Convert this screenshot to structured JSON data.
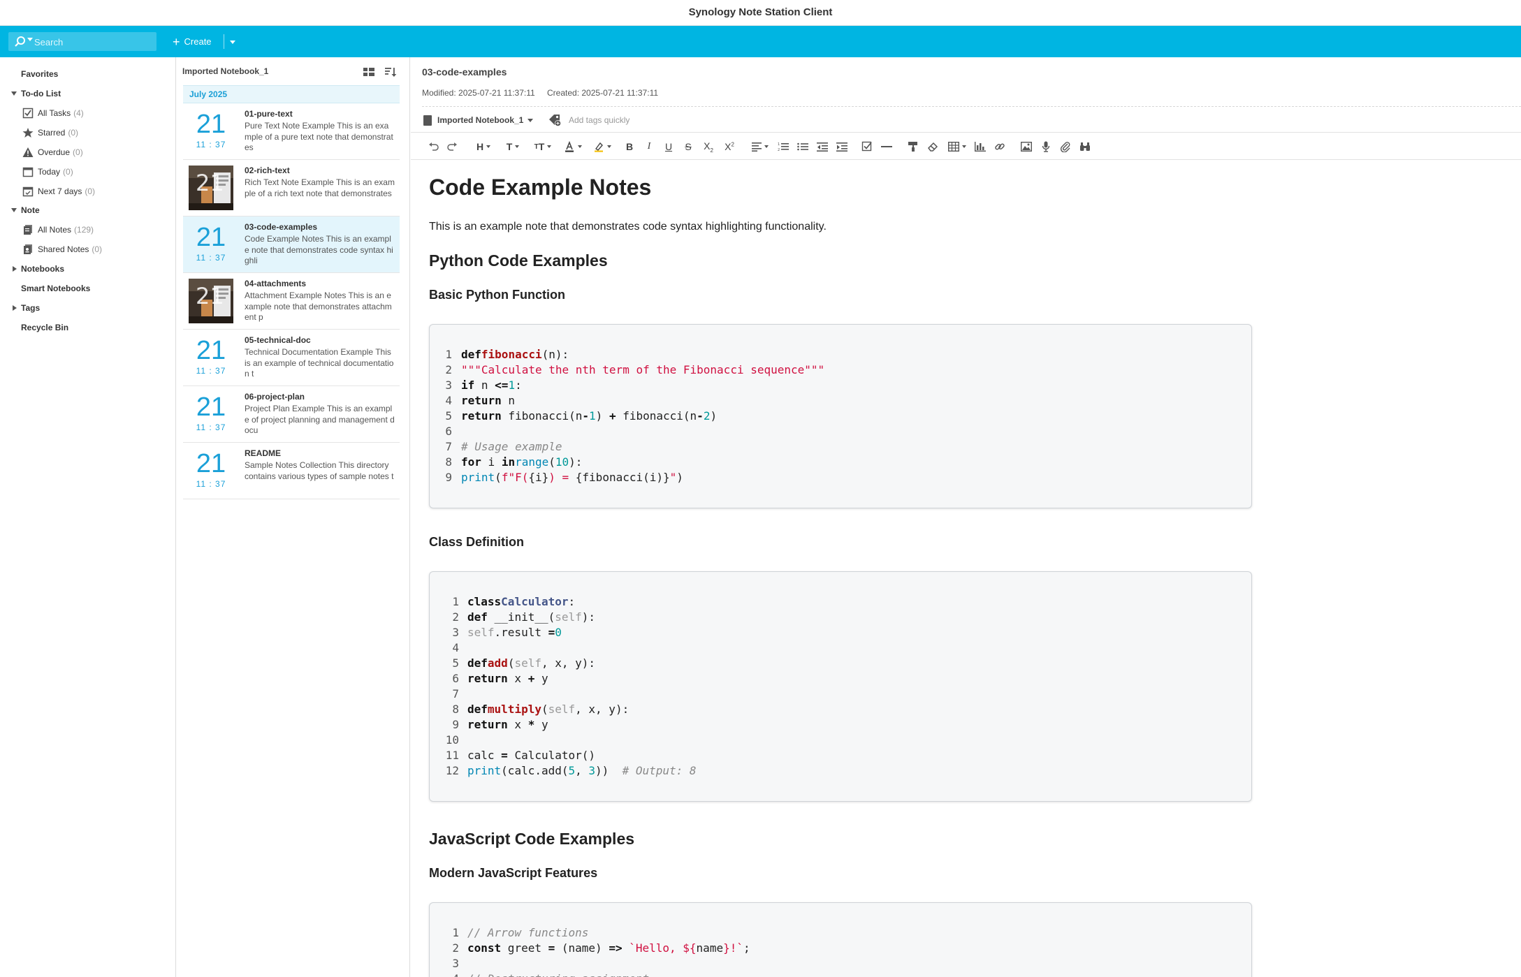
{
  "window": {
    "title": "Synology Note Station Client"
  },
  "topbar": {
    "search_placeholder": "Search",
    "create_label": "Create"
  },
  "sidebar": {
    "favorites": "Favorites",
    "todo": "To-do List",
    "todo_items": [
      {
        "label": "All Tasks",
        "count": "(4)"
      },
      {
        "label": "Starred",
        "count": "(0)"
      },
      {
        "label": "Overdue",
        "count": "(0)"
      },
      {
        "label": "Today",
        "count": "(0)"
      },
      {
        "label": "Next 7 days",
        "count": "(0)"
      }
    ],
    "note": "Note",
    "note_items": [
      {
        "label": "All Notes",
        "count": "(129)"
      },
      {
        "label": "Shared Notes",
        "count": "(0)"
      }
    ],
    "notebooks": "Notebooks",
    "smart_notebooks": "Smart Notebooks",
    "tags": "Tags",
    "recycle_bin": "Recycle Bin"
  },
  "notelist": {
    "notebook": "Imported Notebook_1",
    "month": "July 2025",
    "notes": [
      {
        "day": "21",
        "time": "11 : 37",
        "title": "01-pure-text",
        "summary": "Pure Text Note Example This is an example of a pure text note that demonstrates",
        "thumb": false
      },
      {
        "day": "21",
        "time": "11 : 37",
        "title": "02-rich-text",
        "summary": "Rich Text Note Example This is an example of a rich text note that demonstrates",
        "thumb": true
      },
      {
        "day": "21",
        "time": "11 : 37",
        "title": "03-code-examples",
        "summary": "Code Example Notes This is an example note that demonstrates code syntax highli",
        "thumb": false,
        "selected": true
      },
      {
        "day": "21",
        "time": "11 : 37",
        "title": "04-attachments",
        "summary": "Attachment Example Notes This is an example note that demonstrates attachment p",
        "thumb": true
      },
      {
        "day": "21",
        "time": "11 : 37",
        "title": "05-technical-doc",
        "summary": "Technical Documentation Example This is an example of technical documentation t",
        "thumb": false
      },
      {
        "day": "21",
        "time": "11 : 37",
        "title": "06-project-plan",
        "summary": "Project Plan Example This is an example of project planning and management docu",
        "thumb": false
      },
      {
        "day": "21",
        "time": "11 : 37",
        "title": "README",
        "summary": "Sample Notes Collection This directory contains various types of sample notes t",
        "thumb": false
      }
    ]
  },
  "editor": {
    "note_title": "03-code-examples",
    "modified": "Modified: 2025-07-21 11:37:11",
    "created": "Created: 2025-07-21 11:37:11",
    "notebook": "Imported Notebook_1",
    "tags_placeholder": "Add tags quickly",
    "doc": {
      "h1": "Code Example Notes",
      "intro": "This is an example note that demonstrates code syntax highlighting functionality.",
      "h2_python": "Python Code Examples",
      "h3_basic": "Basic Python Function",
      "h3_class": "Class Definition",
      "h2_js": "JavaScript Code Examples",
      "h3_js": "Modern JavaScript Features"
    }
  }
}
